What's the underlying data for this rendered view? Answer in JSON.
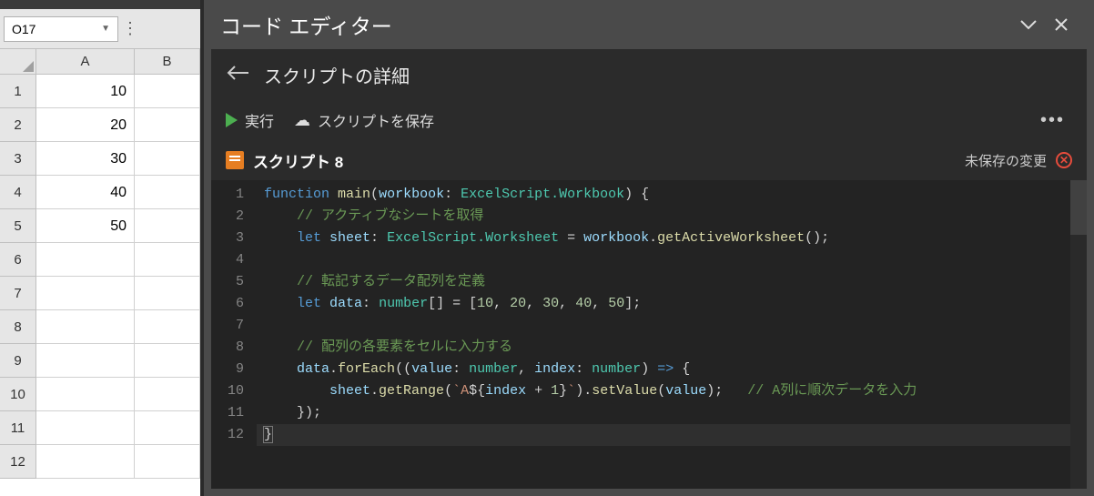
{
  "spreadsheet": {
    "name_box_value": "O17",
    "columns": [
      "A",
      "B"
    ],
    "rows": [
      {
        "num": "1",
        "a": "10",
        "b": ""
      },
      {
        "num": "2",
        "a": "20",
        "b": ""
      },
      {
        "num": "3",
        "a": "30",
        "b": ""
      },
      {
        "num": "4",
        "a": "40",
        "b": ""
      },
      {
        "num": "5",
        "a": "50",
        "b": ""
      },
      {
        "num": "6",
        "a": "",
        "b": ""
      },
      {
        "num": "7",
        "a": "",
        "b": ""
      },
      {
        "num": "8",
        "a": "",
        "b": ""
      },
      {
        "num": "9",
        "a": "",
        "b": ""
      },
      {
        "num": "10",
        "a": "",
        "b": ""
      },
      {
        "num": "11",
        "a": "",
        "b": ""
      },
      {
        "num": "12",
        "a": "",
        "b": ""
      }
    ]
  },
  "editor": {
    "title": "コード エディター",
    "breadcrumb": "スクリプトの詳細",
    "actions": {
      "run": "実行",
      "save": "スクリプトを保存"
    },
    "script_name": "スクリプト 8",
    "unsaved_label": "未保存の変更",
    "code": {
      "line1": {
        "kw": "function",
        "fn": "main",
        "p1": "(",
        "var": "workbook",
        "colon": ": ",
        "type": "ExcelScript.Workbook",
        "p2": ") {"
      },
      "line2": {
        "indent": "    ",
        "comment": "// アクティブなシートを取得"
      },
      "line3": {
        "indent": "    ",
        "kw": "let ",
        "var1": "sheet",
        "colon": ": ",
        "type": "ExcelScript.Worksheet",
        "eq": " = ",
        "var2": "workbook",
        "dot": ".",
        "fn": "getActiveWorksheet",
        "p": "();"
      },
      "line4": {
        "indent": ""
      },
      "line5": {
        "indent": "    ",
        "comment": "// 転記するデータ配列を定義"
      },
      "line6": {
        "indent": "    ",
        "kw": "let ",
        "var": "data",
        "colon": ": ",
        "type": "number",
        "br": "[] = [",
        "n1": "10",
        "c1": ", ",
        "n2": "20",
        "c2": ", ",
        "n3": "30",
        "c3": ", ",
        "n4": "40",
        "c4": ", ",
        "n5": "50",
        "end": "];"
      },
      "line7": {
        "indent": ""
      },
      "line8": {
        "indent": "    ",
        "comment": "// 配列の各要素をセルに入力する"
      },
      "line9": {
        "indent": "    ",
        "var": "data",
        "dot": ".",
        "fn": "forEach",
        "p1": "((",
        "var2": "value",
        "colon1": ": ",
        "type1": "number",
        "c1": ", ",
        "var3": "index",
        "colon2": ": ",
        "type2": "number",
        "p2": ") ",
        "arrow": "=>",
        "p3": " {"
      },
      "line10": {
        "indent": "        ",
        "var": "sheet",
        "dot": ".",
        "fn1": "getRange",
        "p1": "(",
        "str1": "`A",
        "tpl1": "${",
        "var2": "index",
        "plus": " + ",
        "n": "1",
        "tpl2": "}",
        "str2": "`",
        "p2": ").",
        "fn2": "setValue",
        "p3": "(",
        "var3": "value",
        "p4": ");   ",
        "comment": "// A列に順次データを入力"
      },
      "line11": {
        "indent": "    ",
        "p": "});"
      },
      "line12": {
        "p": "}"
      }
    },
    "line_numbers": [
      "1",
      "2",
      "3",
      "4",
      "5",
      "6",
      "7",
      "8",
      "9",
      "10",
      "11",
      "12"
    ]
  }
}
